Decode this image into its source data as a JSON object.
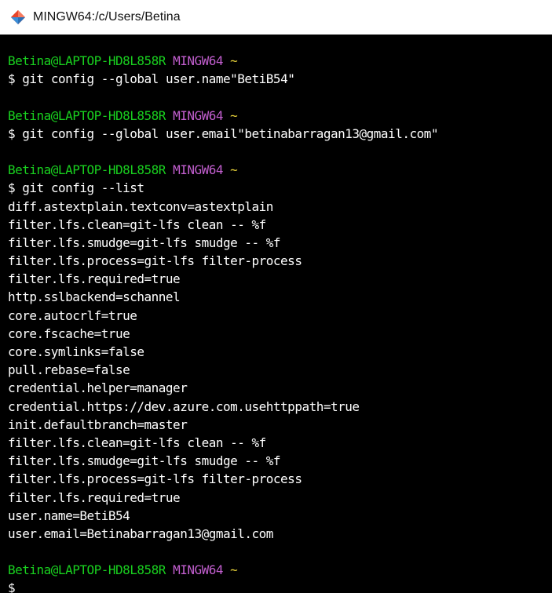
{
  "window": {
    "title": "MINGW64:/c/Users/Betina",
    "icon": "git-bash-icon",
    "colors": {
      "background": "#000000",
      "prompt_user": "#19d11f",
      "prompt_env": "#c35fd0",
      "prompt_cwd": "#e8d23a",
      "text": "#ffffff"
    }
  },
  "prompt": {
    "user_host": "Betina@LAPTOP-HD8L858R",
    "env": "MINGW64",
    "cwd": "~",
    "symbol": "$"
  },
  "blocks": [
    {
      "command": "git config --global user.name\"BetiB54\"",
      "output": []
    },
    {
      "command": "git config --global user.email\"betinabarragan13@gmail.com\"",
      "output": []
    },
    {
      "command": "git config --list",
      "output": [
        "diff.astextplain.textconv=astextplain",
        "filter.lfs.clean=git-lfs clean -- %f",
        "filter.lfs.smudge=git-lfs smudge -- %f",
        "filter.lfs.process=git-lfs filter-process",
        "filter.lfs.required=true",
        "http.sslbackend=schannel",
        "core.autocrlf=true",
        "core.fscache=true",
        "core.symlinks=false",
        "pull.rebase=false",
        "credential.helper=manager",
        "credential.https://dev.azure.com.usehttppath=true",
        "init.defaultbranch=master",
        "filter.lfs.clean=git-lfs clean -- %f",
        "filter.lfs.smudge=git-lfs smudge -- %f",
        "filter.lfs.process=git-lfs filter-process",
        "filter.lfs.required=true",
        "user.name=BetiB54",
        "user.email=Betinabarragan13@gmail.com"
      ]
    },
    {
      "command": "",
      "output": []
    }
  ]
}
